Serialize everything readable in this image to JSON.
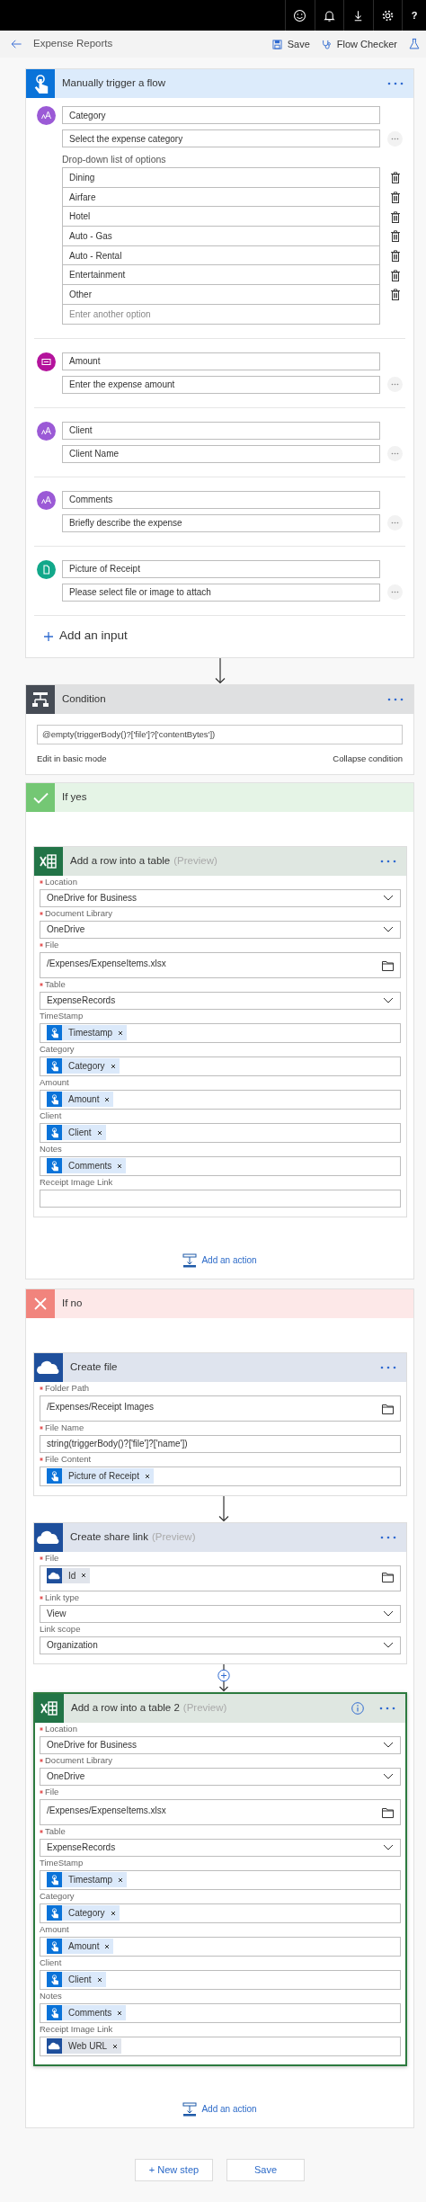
{
  "top_bar": {
    "help": "?"
  },
  "toolbar": {
    "title": "Expense Reports",
    "actions": [
      {
        "kind": "save",
        "label": "Save"
      },
      {
        "kind": "checker",
        "label": "Flow Checker"
      },
      {
        "kind": "test"
      }
    ]
  },
  "trigger": {
    "title": "Manually trigger a flow",
    "inputs": [
      {
        "kind": "text",
        "name": "Category",
        "description": "Select the expense category",
        "options_label": "Drop-down list of options",
        "options": [
          "Dining",
          "Airfare",
          "Hotel",
          "Auto - Gas",
          "Auto - Rental",
          "Entertainment",
          "Other"
        ],
        "option_placeholder": "Enter another option"
      },
      {
        "kind": "number",
        "name": "Amount",
        "description": "Enter the expense amount"
      },
      {
        "kind": "text",
        "name": "Client",
        "description": "Client Name"
      },
      {
        "kind": "text",
        "name": "Comments",
        "description": "Briefly describe the expense"
      },
      {
        "kind": "file",
        "name": "Picture of Receipt",
        "description": "Please select file or image to attach"
      }
    ],
    "add_input": "Add an input"
  },
  "condition": {
    "title": "Condition",
    "expression": "@empty(triggerBody()?['file']?['contentBytes'])",
    "edit_link": "Edit in basic mode",
    "collapse_link": "Collapse condition"
  },
  "branches": [
    {
      "kind": "yes",
      "title": "If yes",
      "add_action": "Add an action",
      "actions": [
        {
          "kind": "excel",
          "title": "Add a row into a table",
          "tag": "(Preview)",
          "selected": false,
          "info": false,
          "fields": [
            {
              "kind": "dropdown",
              "label": "Location",
              "required": true,
              "value": "OneDrive for Business"
            },
            {
              "kind": "dropdown",
              "label": "Document Library",
              "required": true,
              "value": "OneDrive"
            },
            {
              "kind": "file",
              "label": "File",
              "required": true,
              "value": "/Expenses/ExpenseItems.xlsx"
            },
            {
              "kind": "dropdown",
              "label": "Table",
              "required": true,
              "value": "ExpenseRecords"
            },
            {
              "kind": "tokens",
              "label": "TimeStamp",
              "required": false,
              "tokens": [
                {
                  "kind": "trigger",
                  "label": "Timestamp"
                }
              ]
            },
            {
              "kind": "tokens",
              "label": "Category",
              "required": false,
              "tokens": [
                {
                  "kind": "trigger",
                  "label": "Category"
                }
              ]
            },
            {
              "kind": "tokens",
              "label": "Amount",
              "required": false,
              "tokens": [
                {
                  "kind": "trigger",
                  "label": "Amount"
                }
              ]
            },
            {
              "kind": "tokens",
              "label": "Client",
              "required": false,
              "tokens": [
                {
                  "kind": "trigger",
                  "label": "Client"
                }
              ]
            },
            {
              "kind": "tokens",
              "label": "Notes",
              "required": false,
              "tokens": [
                {
                  "kind": "trigger",
                  "label": "Comments"
                }
              ]
            },
            {
              "kind": "text",
              "label": "Receipt Image Link",
              "required": false
            }
          ]
        }
      ]
    },
    {
      "kind": "no",
      "title": "If no",
      "add_action": "Add an action",
      "actions": [
        {
          "kind": "onedrive",
          "title": "Create file",
          "selected": false,
          "info": false,
          "fields": [
            {
              "kind": "file",
              "label": "Folder Path",
              "required": true,
              "value": "/Expenses/Receipt Images"
            },
            {
              "kind": "text",
              "label": "File Name",
              "required": true,
              "value": "string(triggerBody()?['file']?['name'])"
            },
            {
              "kind": "tokens",
              "label": "File Content",
              "required": true,
              "tokens": [
                {
                  "kind": "trigger",
                  "label": "Picture of Receipt"
                }
              ]
            }
          ]
        },
        {
          "link": {
            "kind": "arrow"
          },
          "kind": "onedrive",
          "title": "Create share link",
          "tag": "(Preview)",
          "selected": false,
          "info": false,
          "fields": [
            {
              "kind": "file",
              "label": "File",
              "required": true,
              "tokens": [
                {
                  "kind": "onedrive",
                  "label": "Id"
                }
              ]
            },
            {
              "kind": "dropdown",
              "label": "Link type",
              "required": true,
              "value": "View"
            },
            {
              "kind": "dropdown",
              "label": "Link scope",
              "required": false,
              "value": "Organization"
            }
          ]
        },
        {
          "link": {
            "kind": "insert"
          },
          "kind": "excel",
          "title": "Add a row into a table 2",
          "tag": "(Preview)",
          "selected": true,
          "info": true,
          "fields": [
            {
              "kind": "dropdown",
              "label": "Location",
              "required": true,
              "value": "OneDrive for Business"
            },
            {
              "kind": "dropdown",
              "label": "Document Library",
              "required": true,
              "value": "OneDrive"
            },
            {
              "kind": "file",
              "label": "File",
              "required": true,
              "value": "/Expenses/ExpenseItems.xlsx"
            },
            {
              "kind": "dropdown",
              "label": "Table",
              "required": true,
              "value": "ExpenseRecords"
            },
            {
              "kind": "tokens",
              "label": "TimeStamp",
              "required": false,
              "tokens": [
                {
                  "kind": "trigger",
                  "label": "Timestamp"
                }
              ]
            },
            {
              "kind": "tokens",
              "label": "Category",
              "required": false,
              "tokens": [
                {
                  "kind": "trigger",
                  "label": "Category"
                }
              ]
            },
            {
              "kind": "tokens",
              "label": "Amount",
              "required": false,
              "tokens": [
                {
                  "kind": "trigger",
                  "label": "Amount"
                }
              ]
            },
            {
              "kind": "tokens",
              "label": "Client",
              "required": false,
              "tokens": [
                {
                  "kind": "trigger",
                  "label": "Client"
                }
              ]
            },
            {
              "kind": "tokens",
              "label": "Notes",
              "required": false,
              "tokens": [
                {
                  "kind": "trigger",
                  "label": "Comments"
                }
              ]
            },
            {
              "kind": "tokens",
              "label": "Receipt Image Link",
              "required": false,
              "tokens": [
                {
                  "kind": "onedrive",
                  "label": "Web URL"
                }
              ]
            }
          ]
        }
      ]
    }
  ],
  "footer": {
    "buttons": [
      "+ New step",
      "Save"
    ]
  }
}
